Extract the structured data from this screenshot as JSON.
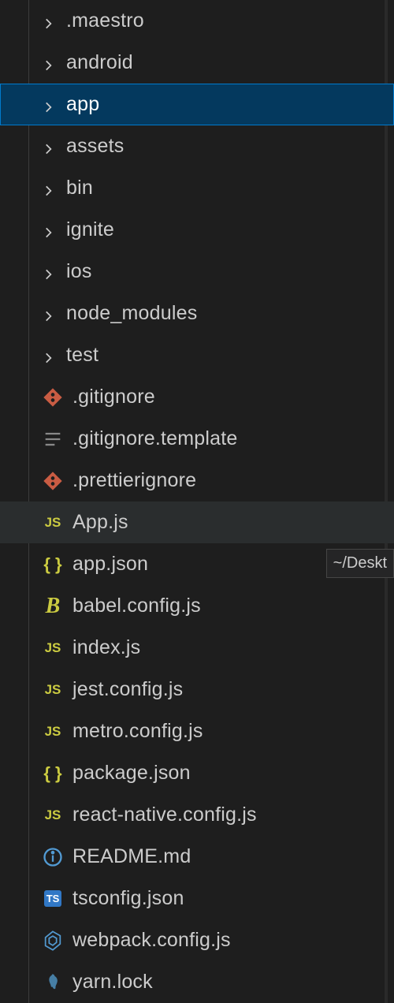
{
  "tooltip": "~/Deskt",
  "items": [
    {
      "name": ".maestro",
      "type": "folder",
      "state": "normal"
    },
    {
      "name": "android",
      "type": "folder",
      "state": "normal"
    },
    {
      "name": "app",
      "type": "folder",
      "state": "selected"
    },
    {
      "name": "assets",
      "type": "folder",
      "state": "normal"
    },
    {
      "name": "bin",
      "type": "folder",
      "state": "normal"
    },
    {
      "name": "ignite",
      "type": "folder",
      "state": "normal"
    },
    {
      "name": "ios",
      "type": "folder",
      "state": "normal"
    },
    {
      "name": "node_modules",
      "type": "folder",
      "state": "normal"
    },
    {
      "name": "test",
      "type": "folder",
      "state": "normal"
    },
    {
      "name": ".gitignore",
      "type": "git",
      "state": "normal"
    },
    {
      "name": ".gitignore.template",
      "type": "template",
      "state": "normal"
    },
    {
      "name": ".prettierignore",
      "type": "git",
      "state": "normal"
    },
    {
      "name": "App.js",
      "type": "js",
      "state": "highlight"
    },
    {
      "name": "app.json",
      "type": "json",
      "state": "normal"
    },
    {
      "name": "babel.config.js",
      "type": "babel",
      "state": "normal"
    },
    {
      "name": "index.js",
      "type": "js",
      "state": "normal"
    },
    {
      "name": "jest.config.js",
      "type": "js",
      "state": "normal"
    },
    {
      "name": "metro.config.js",
      "type": "js",
      "state": "normal"
    },
    {
      "name": "package.json",
      "type": "json",
      "state": "normal"
    },
    {
      "name": "react-native.config.js",
      "type": "js",
      "state": "normal"
    },
    {
      "name": "README.md",
      "type": "readme",
      "state": "normal"
    },
    {
      "name": "tsconfig.json",
      "type": "ts",
      "state": "normal"
    },
    {
      "name": "webpack.config.js",
      "type": "webpack",
      "state": "normal"
    },
    {
      "name": "yarn.lock",
      "type": "yarn",
      "state": "normal"
    }
  ]
}
